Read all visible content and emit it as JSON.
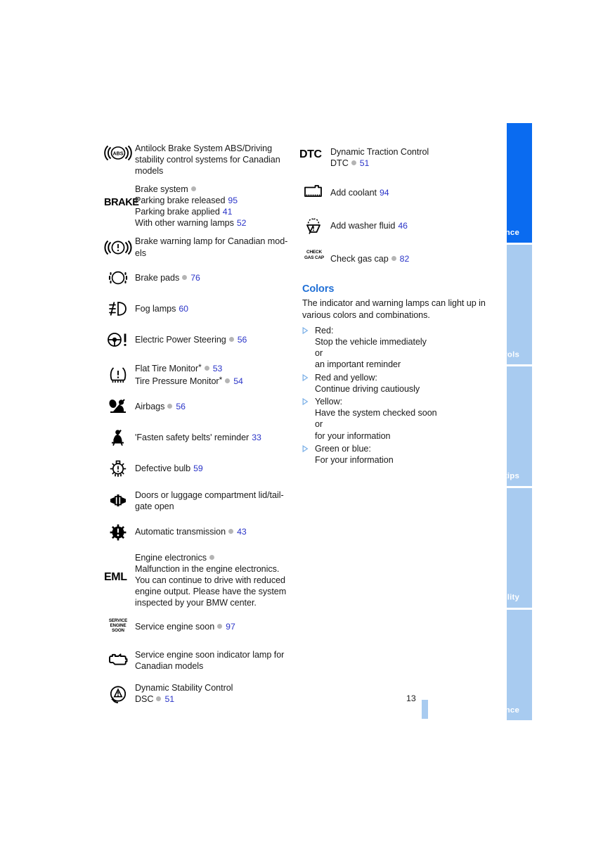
{
  "document": {
    "page_number": "13",
    "accent_blue": "#1f6fd6",
    "link_blue": "#2b35c8",
    "tab_active_color": "#0a6bf0",
    "tab_inactive_color": "#a8cbf0"
  },
  "left_column": {
    "entries": [
      {
        "icon": "abs-warning-icon",
        "lines": [
          {
            "text": "Antilock Brake System ABS/Driving"
          },
          {
            "text": "stability control systems for Canadian"
          },
          {
            "text": "models"
          }
        ]
      },
      {
        "icon": "brake-text-icon",
        "lines": [
          {
            "text": "Brake system",
            "dot": true
          },
          {
            "text": "Parking brake released",
            "page": "95"
          },
          {
            "text": "Parking brake applied",
            "page": "41"
          },
          {
            "text": "With other warning lamps",
            "page": "52"
          }
        ]
      },
      {
        "icon": "brake-warning-lamp-icon",
        "lines": [
          {
            "text": "Brake warning lamp for Canadian mod-"
          },
          {
            "text": "els"
          }
        ]
      },
      {
        "icon": "brake-pads-icon",
        "lines": [
          {
            "text": "Brake pads",
            "dot": true,
            "page": "76"
          }
        ]
      },
      {
        "icon": "fog-lamps-icon",
        "lines": [
          {
            "text": "Fog lamps",
            "page": "60"
          }
        ]
      },
      {
        "icon": "electric-power-steering-icon",
        "lines": [
          {
            "text": "Electric Power Steering",
            "dot": true,
            "page": "56"
          }
        ]
      },
      {
        "icon": "tire-monitor-icon",
        "lines": [
          {
            "text": "Flat Tire Monitor",
            "star": true,
            "dot": true,
            "page": "53"
          },
          {
            "text": "Tire Pressure Monitor",
            "star": true,
            "dot": true,
            "page": "54"
          }
        ]
      },
      {
        "icon": "airbags-icon",
        "lines": [
          {
            "text": "Airbags",
            "dot": true,
            "page": "56"
          }
        ]
      },
      {
        "icon": "seat-belt-reminder-icon",
        "lines": [
          {
            "text": "'Fasten safety belts' reminder",
            "page": "33"
          }
        ]
      },
      {
        "icon": "defective-bulb-icon",
        "lines": [
          {
            "text": "Defective bulb",
            "page": "59"
          }
        ]
      },
      {
        "icon": "doors-open-icon",
        "lines": [
          {
            "text": "Doors or luggage compartment lid/tail-"
          },
          {
            "text": "gate open"
          }
        ]
      },
      {
        "icon": "automatic-transmission-icon",
        "lines": [
          {
            "text": "Automatic transmission",
            "dot": true,
            "page": "43"
          }
        ]
      },
      {
        "icon": "eml-text-icon",
        "lines": [
          {
            "text": "Engine electronics",
            "dot": true
          },
          {
            "text": "Malfunction in the engine electronics."
          },
          {
            "text": "You can continue to drive with reduced"
          },
          {
            "text": "engine output. Please have the system"
          },
          {
            "text": "inspected by your BMW center."
          }
        ]
      },
      {
        "icon": "service-engine-soon-text-icon",
        "lines": [
          {
            "text": "Service engine soon",
            "dot": true,
            "page": "97"
          }
        ]
      },
      {
        "icon": "check-engine-icon",
        "lines": [
          {
            "text": "Service engine soon indicator lamp for"
          },
          {
            "text": "Canadian models"
          }
        ]
      },
      {
        "icon": "dsc-icon",
        "lines": [
          {
            "text": "Dynamic Stability Control"
          },
          {
            "text": "DSC",
            "dot": true,
            "page": "51"
          }
        ]
      }
    ]
  },
  "right_column": {
    "entries": [
      {
        "icon": "dtc-text-icon",
        "lines": [
          {
            "text": "Dynamic Traction Control"
          },
          {
            "text": "DTC",
            "dot": true,
            "page": "51"
          }
        ]
      },
      {
        "icon": "add-coolant-icon",
        "lines": [
          {
            "text": "Add coolant",
            "page": "94"
          }
        ]
      },
      {
        "icon": "add-washer-fluid-icon",
        "lines": [
          {
            "text": "Add washer fluid",
            "page": "46"
          }
        ]
      },
      {
        "icon": "check-gas-cap-text-icon",
        "lines": [
          {
            "text": "Check gas cap",
            "dot": true,
            "page": "82"
          }
        ]
      }
    ],
    "colors_section": {
      "heading": "Colors",
      "intro_lines": [
        "The indicator and warning lamps can light up in",
        "various colors and combinations."
      ],
      "bullets": [
        {
          "lines": [
            "Red:",
            "Stop the vehicle immediately",
            "or",
            "an important reminder"
          ]
        },
        {
          "lines": [
            "Red and yellow:",
            "Continue driving cautiously"
          ]
        },
        {
          "lines": [
            "Yellow:",
            "Have the system checked soon",
            "or",
            "for your information"
          ]
        },
        {
          "lines": [
            "Green or blue:",
            "For your information"
          ]
        }
      ]
    }
  },
  "side_tabs": {
    "items": [
      {
        "label": "At a glance",
        "active": true
      },
      {
        "label": "Controls",
        "active": false
      },
      {
        "label": "Driving tips",
        "active": false
      },
      {
        "label": "Mobility",
        "active": false
      },
      {
        "label": "Reference",
        "active": false
      }
    ]
  }
}
